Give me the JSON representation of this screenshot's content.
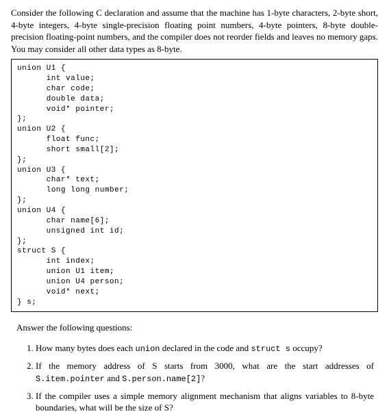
{
  "intro": "Consider the following C declaration and assume that the machine has 1-byte characters, 2-byte short, 4-byte integers, 4-byte single-precision floating point numbers, 4-byte pointers, 8-byte double-precision floating-point numbers, and the compiler does not reorder fields and leaves no memory gaps. You may consider all other data types as 8-byte.",
  "code": "union U1 {\n      int value;\n      char code;\n      double data;\n      void* pointer;\n};\nunion U2 {\n      float func;\n      short small[2];\n};\nunion U3 {\n      char* text;\n      long long number;\n};\nunion U4 {\n      char name[6];\n      unsigned int id;\n};\nstruct S {\n      int index;\n      union U1 item;\n      union U4 person;\n      void* next;\n} s;",
  "prompt": "Answer the following questions:",
  "questions": {
    "q1_a": "How many bytes does each ",
    "q1_b": " declared in the code and ",
    "q1_c": " occupy?",
    "q1_union": "union",
    "q1_struct": "struct s",
    "q2_a": "If the memory address of S starts from 3000, what are the start addresses of ",
    "q2_item": "S.item.pointer",
    "q2_mid": " and ",
    "q2_person": "S.person.name[2]",
    "q2_end": "?",
    "q3": "If the compiler uses a simple memory alignment mechanism that aligns variables to 8-byte boundaries, what will be the size of S?"
  }
}
